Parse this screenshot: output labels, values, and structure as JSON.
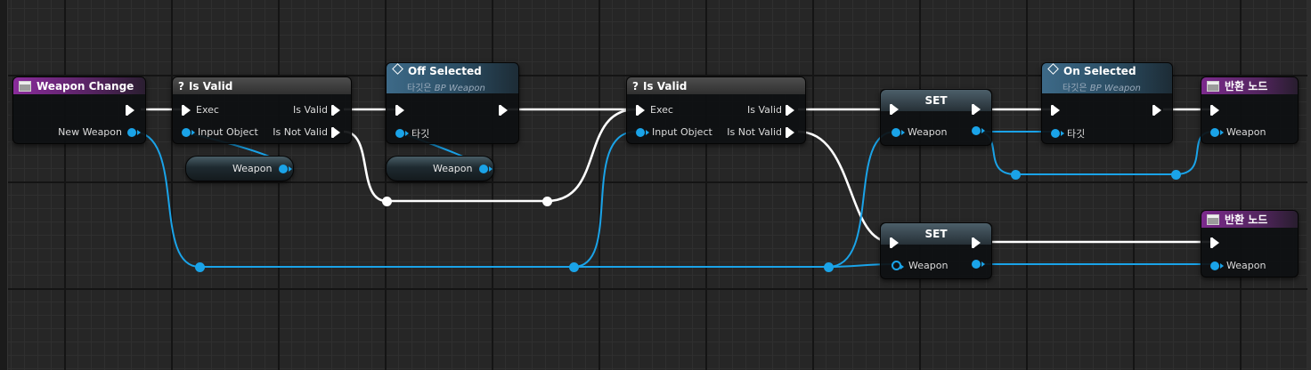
{
  "graph": {
    "accent_exec": "#ffffff",
    "accent_data": "#1aa3e8",
    "nodes": {
      "weapon_change": {
        "title": "Weapon Change",
        "icon": "event-box-icon",
        "pin_new_weapon": "New Weapon"
      },
      "is_valid_1": {
        "title": "Is Valid",
        "icon": "question-icon",
        "pin_exec": "Exec",
        "pin_input": "Input Object",
        "pin_is_valid": "Is Valid",
        "pin_not_valid": "Is Not Valid"
      },
      "weapon_get_1": {
        "label": "Weapon"
      },
      "off_selected": {
        "title": "Off Selected",
        "subtitle_prefix": "타깃은",
        "subtitle_class": "BP Weapon",
        "pin_target": "타깃",
        "icon": "function-diamond-icon"
      },
      "weapon_get_2": {
        "label": "Weapon"
      },
      "is_valid_2": {
        "title": "Is Valid",
        "icon": "question-icon",
        "pin_exec": "Exec",
        "pin_input": "Input Object",
        "pin_is_valid": "Is Valid",
        "pin_not_valid": "Is Not Valid"
      },
      "set_1": {
        "title": "SET",
        "pin_weapon": "Weapon"
      },
      "set_2": {
        "title": "SET",
        "pin_weapon": "Weapon"
      },
      "on_selected": {
        "title": "On Selected",
        "subtitle_prefix": "타깃은",
        "subtitle_class": "BP Weapon",
        "pin_target": "타깃",
        "icon": "function-diamond-icon"
      },
      "return_1": {
        "title": "반환 노드",
        "pin_weapon": "Weapon",
        "icon": "return-box-icon"
      },
      "return_2": {
        "title": "반환 노드",
        "pin_weapon": "Weapon",
        "icon": "return-box-icon"
      }
    }
  }
}
